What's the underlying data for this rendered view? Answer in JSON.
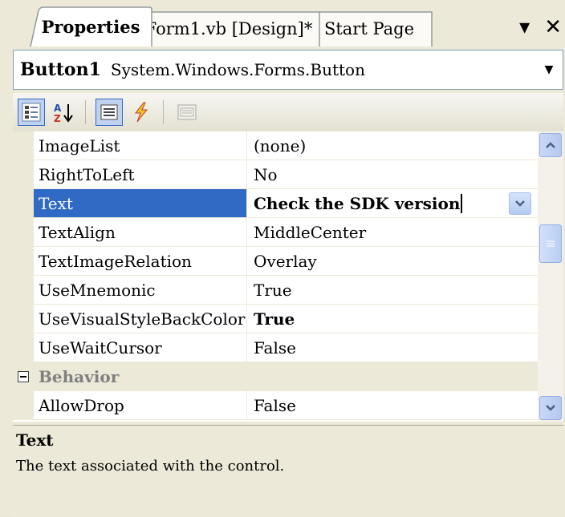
{
  "tabs": [
    {
      "label": "Properties"
    },
    {
      "label": "Form1.vb [Design]*"
    },
    {
      "label": "Start Page"
    }
  ],
  "tab_controls": {
    "dropdown": "▾",
    "close": "✕"
  },
  "object_selector": {
    "name": "Button1",
    "type": "System.Windows.Forms.Button"
  },
  "toolbar": {
    "icons": [
      "categorized-icon",
      "alphabetical-icon",
      "properties-icon",
      "events-icon",
      "property-pages-icon"
    ]
  },
  "grid": {
    "rows": [
      {
        "name": "ImageList",
        "value": "(none)"
      },
      {
        "name": "RightToLeft",
        "value": "No"
      },
      {
        "name": "Text",
        "value": "Check the SDK version"
      },
      {
        "name": "TextAlign",
        "value": "MiddleCenter"
      },
      {
        "name": "TextImageRelation",
        "value": "Overlay"
      },
      {
        "name": "UseMnemonic",
        "value": "True"
      },
      {
        "name": "UseVisualStyleBackColor",
        "value": "True"
      },
      {
        "name": "UseWaitCursor",
        "value": "False"
      }
    ],
    "category": "Behavior",
    "after_category": [
      {
        "name": "AllowDrop",
        "value": "False"
      }
    ]
  },
  "description": {
    "title": "Text",
    "text": "The text associated with the control."
  },
  "colors": {
    "selection": "#316ac5",
    "panel": "#ece9d8",
    "border": "#7f9db9"
  }
}
